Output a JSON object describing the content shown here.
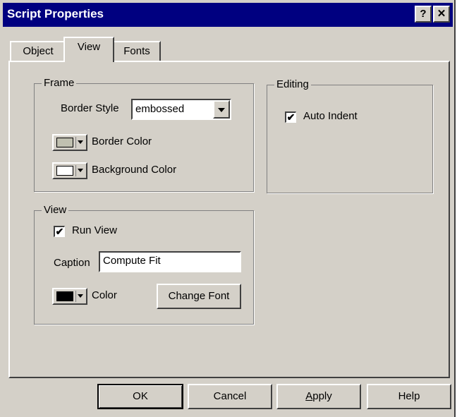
{
  "window": {
    "title": "Script Properties",
    "help_btn": "?",
    "close_btn": "✕"
  },
  "tabs": [
    {
      "label": "Object"
    },
    {
      "label": "View"
    },
    {
      "label": "Fonts"
    }
  ],
  "frame": {
    "legend": "Frame",
    "border_style_label": "Border Style",
    "border_style_value": "embossed",
    "border_color_label": "Border Color",
    "border_color_swatch": "#c0c0b0",
    "background_color_label": "Background Color",
    "background_color_swatch": "#ffffff"
  },
  "editing": {
    "legend": "Editing",
    "auto_indent_label": "Auto Indent",
    "auto_indent_checked": true
  },
  "view": {
    "legend": "View",
    "run_view_label": "Run View",
    "run_view_checked": true,
    "caption_label": "Caption",
    "caption_value": "Compute Fit",
    "color_label": "Color",
    "color_swatch": "#000000",
    "change_font_label": "Change Font"
  },
  "footer": {
    "ok": "OK",
    "cancel": "Cancel",
    "apply_first": "A",
    "apply_rest": "pply",
    "help": "Help"
  },
  "colors": {
    "face": "#d4d0c8",
    "titlebar": "#000080"
  }
}
